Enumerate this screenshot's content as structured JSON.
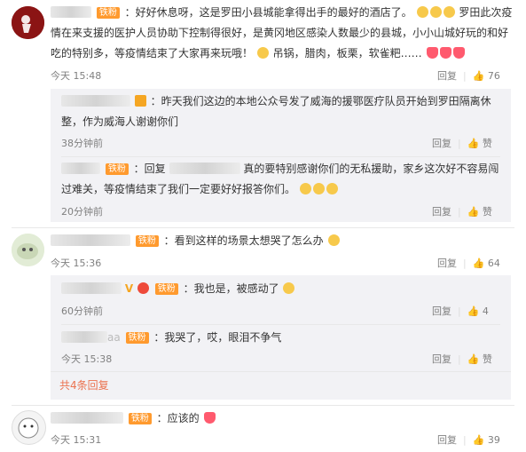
{
  "c1": {
    "badge": "铁粉",
    "l1": "：好好休息呀，这是罗田小县城能拿得出手的最好的酒店了。",
    "l1b": "罗田此次疫",
    "l2": "情在来支援的医护人员协助下控制得很好，是黄冈地区感染人数最少的县城，小小山城好玩的和好",
    "l3a": "吃的特别多，等疫情结束了大家再来玩哦！",
    "l3b": "吊锅，腊肉，板栗，软雀粑……",
    "time": "今天 15:48",
    "reply": "回复",
    "likes": "76"
  },
  "c1r1": {
    "l1": "：昨天我们这边的本地公众号发了威海的援鄂医疗队员开始到罗田隔离休",
    "l2": "整，作为威海人谢谢你们",
    "time": "38分钟前",
    "reply": "回复",
    "like": "赞"
  },
  "c1r2": {
    "badge": "铁粉",
    "a": "：回复",
    "b": "真的要特别感谢你们的无私援助，家乡这次好不容易闯",
    "l2": "过难关，等疫情结束了我们一定要好好报答你们。",
    "time": "20分钟前",
    "reply": "回复",
    "like": "赞"
  },
  "c2": {
    "badge": "铁粉",
    "text": "：看到这样的场景太想哭了怎么办",
    "time": "今天 15:36",
    "reply": "回复",
    "likes": "64"
  },
  "c2r1": {
    "badge": "铁粉",
    "text": "：我也是，被感动了",
    "time": "60分钟前",
    "reply": "回复",
    "likes": "4"
  },
  "c2r2": {
    "name_suffix": "aa",
    "badge": "铁粉",
    "text": "：我哭了，哎，眼泪不争气",
    "time": "今天 15:38",
    "reply": "回复",
    "like": "赞"
  },
  "c2more": "共4条回复",
  "c3": {
    "badge": "铁粉",
    "text": "：应该的",
    "time": "今天 15:31",
    "reply": "回复",
    "likes": "39"
  },
  "colors": {
    "badge": "#ff9a2e",
    "link": "#eb7350",
    "meta": "#808080"
  },
  "icons": [
    "thumbs-up-icon",
    "heart-emoji",
    "crying-face-emoji",
    "sad-face-emoji",
    "v-verified-icon"
  ]
}
